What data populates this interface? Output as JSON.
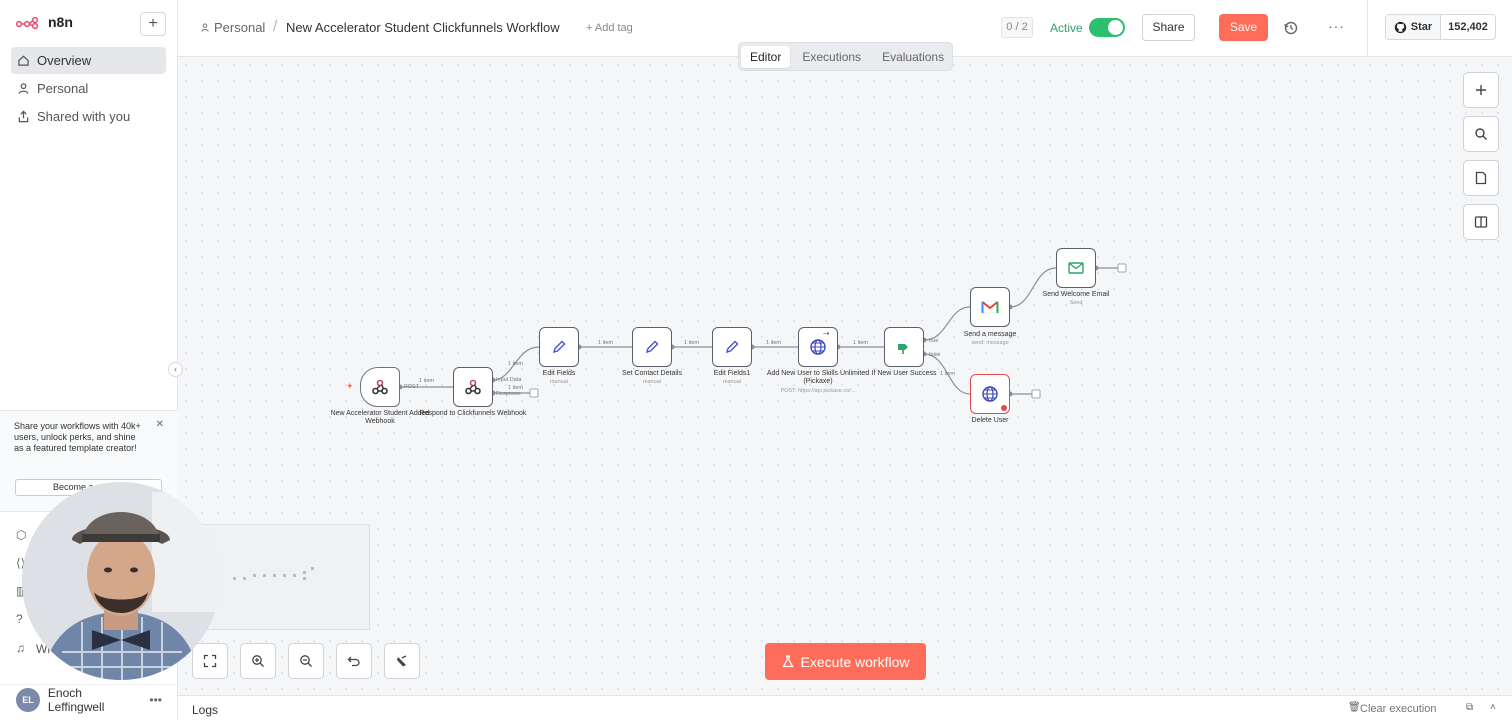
{
  "app": {
    "name": "n8n"
  },
  "sidebar": {
    "items": [
      {
        "label": "Overview"
      },
      {
        "label": "Personal"
      },
      {
        "label": "Shared with you"
      }
    ],
    "promo": {
      "text": "Share your workflows with 40k+ users, unlock perks, and shine as a featured template creator!",
      "button": "Become a creator"
    },
    "bottom_visible_label": "Wi",
    "user": {
      "initials": "EL",
      "name": "Enoch Leffingwell"
    }
  },
  "header": {
    "breadcrumb_project": "Personal",
    "workflow_title": "New Accelerator Student Clickfunnels Workflow",
    "add_tag": "+ Add tag",
    "counter": "0 / 2",
    "active_label": "Active",
    "active": true,
    "share_label": "Share",
    "save_label": "Save",
    "github": {
      "star_label": "Star",
      "count": "152,402"
    }
  },
  "tabs": [
    {
      "label": "Editor",
      "active": true
    },
    {
      "label": "Executions",
      "active": false
    },
    {
      "label": "Evaluations",
      "active": false
    }
  ],
  "workflow": {
    "nodes": [
      {
        "name": "New Accelerator Student Added Webhook",
        "icon": "webhook-icon"
      },
      {
        "name": "Respond to Clickfunnels Webhook",
        "icon": "webhook-icon"
      },
      {
        "name": "Edit Fields",
        "sub": "manual",
        "icon": "pencil-icon"
      },
      {
        "name": "Set Contact Details",
        "sub": "manual",
        "icon": "pencil-icon"
      },
      {
        "name": "Edit Fields1",
        "sub": "manual",
        "icon": "pencil-icon"
      },
      {
        "name": "Add New User to Skills Unlimited (Pickaxe)",
        "sub": "POST: https://api.pickaxe.co/...",
        "icon": "globe-icon"
      },
      {
        "name": "If New User Success",
        "icon": "if-icon"
      },
      {
        "name": "Send a message",
        "sub": "send: message",
        "icon": "gmail-icon"
      },
      {
        "name": "Send Welcome Email",
        "sub": "Send",
        "icon": "email-icon"
      },
      {
        "name": "Delete User",
        "icon": "globe-icon"
      }
    ],
    "edge_labels": {
      "item": "1 item",
      "post": "POST",
      "input_data": "Input Data",
      "response": "Response",
      "true": "true",
      "false": "false"
    }
  },
  "execute_label": "Execute workflow",
  "logs": {
    "label": "Logs",
    "clear_label": "Clear execution"
  },
  "colors": {
    "accent": "#ff6d5a",
    "active_green": "#2cbf6d"
  }
}
